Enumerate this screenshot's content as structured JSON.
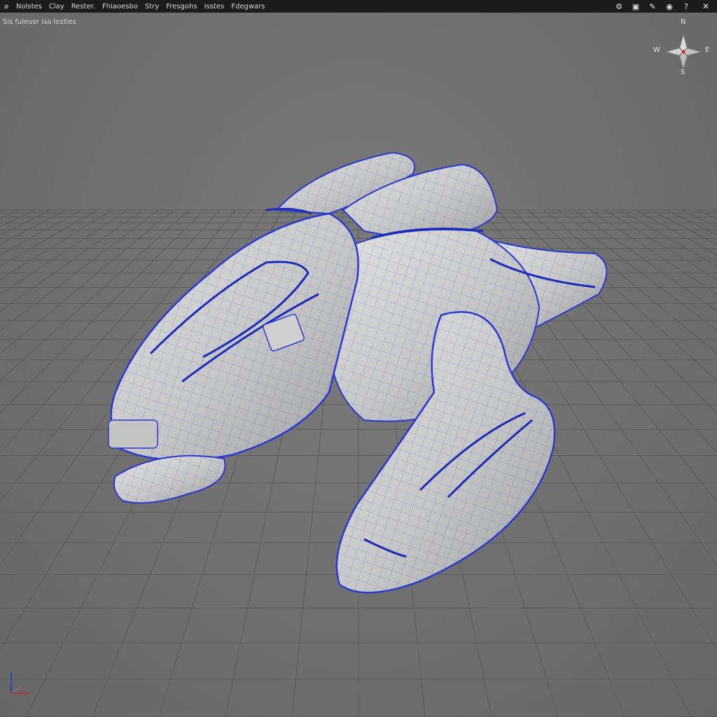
{
  "menubar": {
    "app_icon": "app-logo-icon",
    "items": [
      "Nolstes",
      "Clay",
      "Rester.",
      "Fhiaoesbo",
      "Stry",
      "Fresgohs",
      "Isstes",
      "Fdegwars"
    ],
    "right_tools": [
      {
        "name": "settings-icon",
        "glyph": "⚙"
      },
      {
        "name": "camera-icon",
        "glyph": "▣"
      },
      {
        "name": "brush-icon",
        "glyph": "✎"
      },
      {
        "name": "globe-icon",
        "glyph": "◉"
      },
      {
        "name": "help-icon",
        "glyph": "?"
      },
      {
        "name": "close-icon",
        "glyph": "✕"
      }
    ]
  },
  "viewport": {
    "label": "Sis fuleusr isa lestles"
  },
  "compass": {
    "north": "N",
    "south": "S",
    "east": "E",
    "west": "W"
  },
  "colors": {
    "menubar_bg": "#1c1c1c",
    "viewport_bg": "#6e6e6e",
    "wireframe": "#2233cc",
    "mesh_fill": "#c9c9c9",
    "grid_line": "#5a5a5a",
    "axis_x": "#cc2222",
    "axis_y": "#2233cc"
  }
}
